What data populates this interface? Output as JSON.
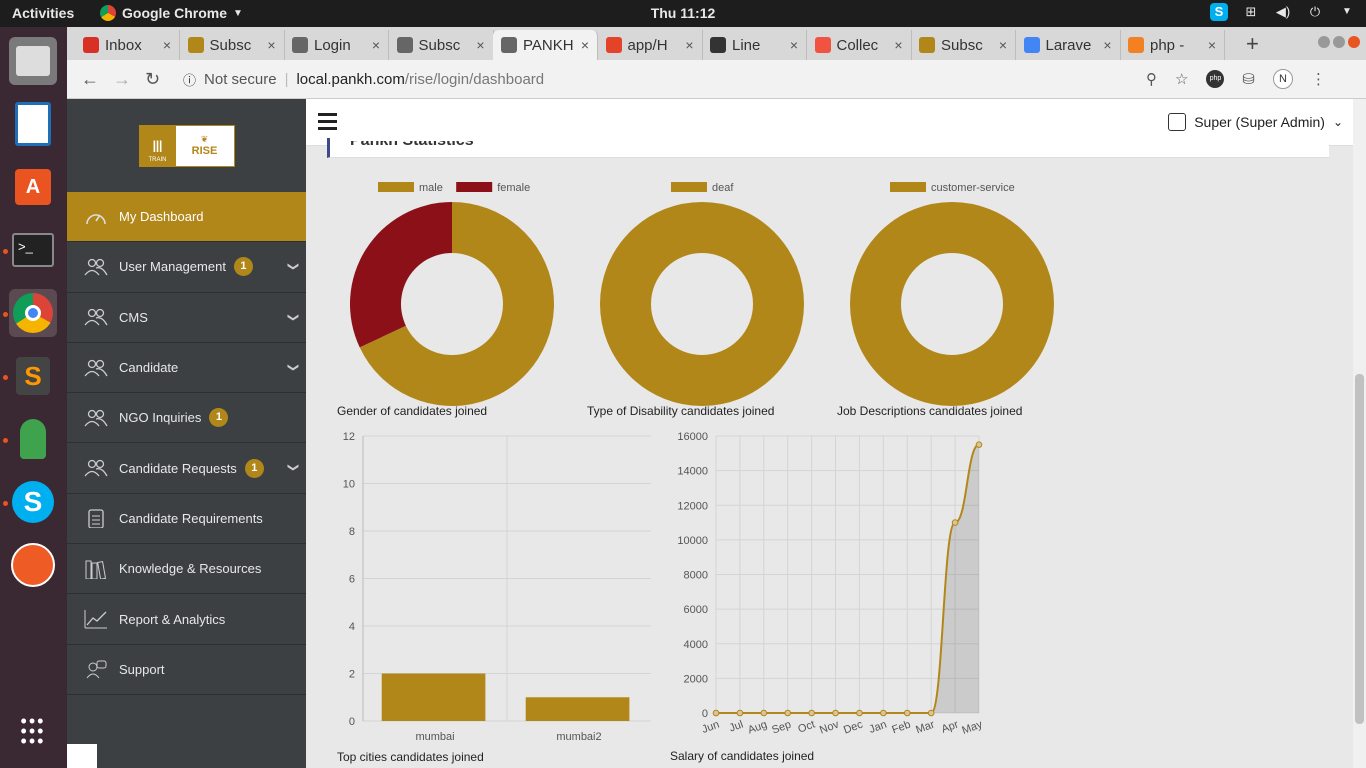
{
  "os": {
    "activities": "Activities",
    "app_name": "Google Chrome",
    "clock": "Thu 11:12"
  },
  "browser": {
    "tabs": [
      {
        "label": "Inbox",
        "icon": "gmail-icon",
        "color": "#d93025"
      },
      {
        "label": "Subsc",
        "icon": "wing-icon",
        "color": "#b28719"
      },
      {
        "label": "Login",
        "icon": "globe-icon",
        "color": "#666666"
      },
      {
        "label": "Subsc",
        "icon": "globe-icon",
        "color": "#666666"
      },
      {
        "label": "PANKH",
        "icon": "globe-icon",
        "color": "#666666"
      },
      {
        "label": "app/H",
        "icon": "gitlab-icon",
        "color": "#e24329"
      },
      {
        "label": "Line",
        "icon": "book-icon",
        "color": "#333333"
      },
      {
        "label": "Collec",
        "icon": "laravel-icon",
        "color": "#f05340"
      },
      {
        "label": "Subsc",
        "icon": "wing-icon",
        "color": "#b28719"
      },
      {
        "label": "Larave",
        "icon": "google-icon",
        "color": "#4285f4"
      },
      {
        "label": "php -",
        "icon": "stackoverflow-icon",
        "color": "#f48024"
      }
    ],
    "active_tab_index": 4,
    "not_secure": "Not secure",
    "url_host": "local.pankh.com",
    "url_path": "/rise/login/dashboard",
    "profile_initial": "N"
  },
  "app": {
    "logo_left": "TRAIN",
    "logo_right": "RISE",
    "user": "Super (Super Admin)",
    "section_title": "Pankh Statistics",
    "menu": [
      {
        "label": "My Dashboard",
        "icon": "dashboard-icon",
        "badge": "",
        "chevron": false,
        "active": true
      },
      {
        "label": "User Management",
        "icon": "users-icon",
        "badge": "1",
        "chevron": true,
        "active": false
      },
      {
        "label": "CMS",
        "icon": "users-icon",
        "badge": "",
        "chevron": true,
        "active": false
      },
      {
        "label": "Candidate",
        "icon": "users-icon",
        "badge": "",
        "chevron": true,
        "active": false
      },
      {
        "label": "NGO Inquiries",
        "icon": "users-icon",
        "badge": "1",
        "chevron": false,
        "active": false
      },
      {
        "label": "Candidate Requests",
        "icon": "users-icon",
        "badge": "1",
        "chevron": true,
        "active": false
      },
      {
        "label": "Candidate Requirements",
        "icon": "clipboard-icon",
        "badge": "",
        "chevron": false,
        "active": false
      },
      {
        "label": "Knowledge & Resources",
        "icon": "books-icon",
        "badge": "",
        "chevron": false,
        "active": false
      },
      {
        "label": "Report & Analytics",
        "icon": "chart-line-icon",
        "badge": "",
        "chevron": false,
        "active": false
      },
      {
        "label": "Support",
        "icon": "support-icon",
        "badge": "",
        "chevron": false,
        "active": false
      }
    ],
    "accent": "#b28719",
    "sidebar_bg": "#3c4043"
  },
  "chart_data": [
    {
      "type": "pie",
      "title": "Gender of candidates joined",
      "labels": [
        "male",
        "female"
      ],
      "values": [
        68,
        32
      ],
      "colors": [
        "#b28719",
        "#8b1018"
      ]
    },
    {
      "type": "pie",
      "title": "Type of Disability candidates joined",
      "labels": [
        "deaf"
      ],
      "values": [
        100
      ],
      "colors": [
        "#b28719"
      ]
    },
    {
      "type": "pie",
      "title": "Job Descriptions candidates joined",
      "labels": [
        "customer-service"
      ],
      "values": [
        100
      ],
      "colors": [
        "#b28719"
      ]
    },
    {
      "type": "bar",
      "title": "Top cities candidates joined",
      "categories": [
        "mumbai",
        "mumbai2"
      ],
      "values": [
        2,
        1
      ],
      "ylim": [
        0,
        12
      ],
      "yticks": [
        0,
        2,
        4,
        6,
        8,
        10,
        12
      ]
    },
    {
      "type": "area",
      "title": "Salary of candidates joined",
      "categories": [
        "Jun",
        "Jul",
        "Aug",
        "Sep",
        "Oct",
        "Nov",
        "Dec",
        "Jan",
        "Feb",
        "Mar",
        "Apr",
        "May"
      ],
      "values": [
        0,
        0,
        0,
        0,
        0,
        0,
        0,
        0,
        0,
        0,
        11000,
        15500
      ],
      "ylim": [
        0,
        16000
      ],
      "yticks": [
        0,
        2000,
        4000,
        6000,
        8000,
        10000,
        12000,
        14000,
        16000
      ]
    }
  ]
}
